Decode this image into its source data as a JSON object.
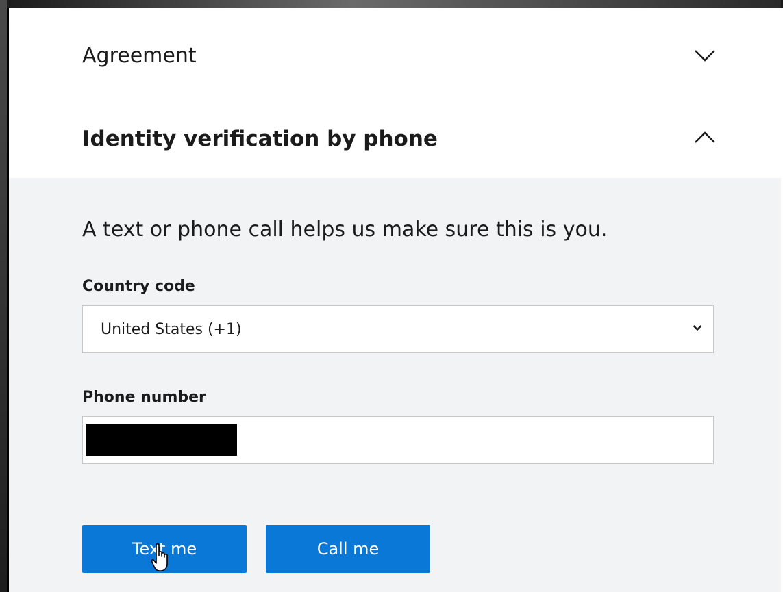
{
  "accordion": {
    "agreement": {
      "title": "Agreement",
      "expanded": false,
      "icon": "chevron-down-icon"
    },
    "identity": {
      "title": "Identity verification by phone",
      "expanded": true,
      "icon": "chevron-up-icon",
      "intro": "A text or phone call helps us make sure this is you.",
      "country_code": {
        "label": "Country code",
        "selected": "United States (+1)"
      },
      "phone_number": {
        "label": "Phone number",
        "redacted": true
      },
      "buttons": {
        "text_me": "Text me",
        "call_me": "Call me"
      }
    }
  },
  "colors": {
    "accent": "#0a78d6",
    "body_background": "#f2f3f5"
  }
}
